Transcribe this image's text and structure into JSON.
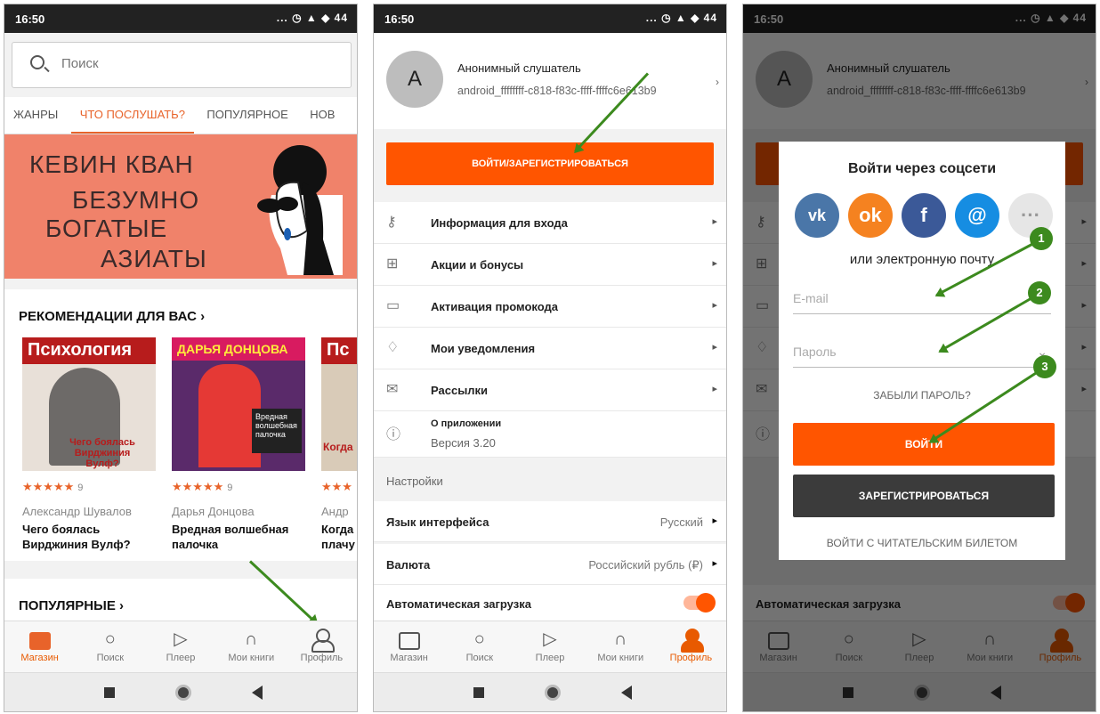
{
  "status": {
    "time": "16:50",
    "icons": "... ◷ ▲ ◆ 44"
  },
  "screen1": {
    "search_placeholder": "Поиск",
    "categories": [
      "ЖАНРЫ",
      "ЧТО ПОСЛУШАТЬ?",
      "ПОПУЛЯРНОЕ",
      "НОВ"
    ],
    "banner": {
      "line1": "КЕВИН КВАН",
      "line2": "БЕЗУМНО",
      "line3": "БОГАТЫЕ",
      "line4": "АЗИАТЫ",
      "color": "#f0826a"
    },
    "rec_title": "РЕКОМЕНДАЦИИ ДЛЯ ВАС",
    "books": [
      {
        "cover_top": "Психология",
        "cover_bottom": "Чего боялась Вирджиния Вулф?",
        "rating": "★★★★★",
        "count": "9",
        "author": "Александр Шувалов",
        "title": "Чего боялась Вирджиния Вулф?"
      },
      {
        "cover_top": "ДАРЬЯ ДОНЦОВА",
        "cover_bottom": "Вредная волшебная палочка",
        "rating": "★★★★★",
        "count": "9",
        "author": "Дарья Донцова",
        "title": "Вредная волшебная палочка"
      },
      {
        "cover_top": "Пс",
        "cover_bottom": "Когда",
        "rating": "★★★",
        "count": "",
        "author": "Андр",
        "title": "Когда плачу"
      }
    ],
    "popular_title": "ПОПУЛЯРНЫЕ"
  },
  "tabs": [
    "Магазин",
    "Поиск",
    "Плеер",
    "Мои книги",
    "Профиль"
  ],
  "profile": {
    "avatar": "A",
    "name": "Анонимный слушатель",
    "id": "android_ffffffff-c818-f83c-ffff-ffffc6e613b9",
    "login_button": "ВОЙТИ/ЗАРЕГИСТРИРОВАТЬСЯ",
    "menu": [
      "Информация для входа",
      "Акции и бонусы",
      "Активация промокода",
      "Мои уведомления",
      "Рассылки"
    ],
    "about": "О приложении",
    "version": "Версия 3.20",
    "settings_label": "Настройки",
    "language_label": "Язык интерфейса",
    "language_value": "Русский",
    "currency_label": "Валюта",
    "currency_value": "Российский рубль (₽)",
    "autoload_label": "Автоматическая загрузка",
    "accent": "#ff5500"
  },
  "dialog": {
    "title": "Войти через соцсети",
    "social": [
      "vk",
      "ok",
      "f",
      "@",
      "···"
    ],
    "or_email": "или электронную почту",
    "email_placeholder": "E-mail",
    "password_placeholder": "Пароль",
    "forgot": "ЗАБЫЛИ ПАРОЛЬ?",
    "login": "ВОЙТИ",
    "register": "ЗАРЕГИСТРИРОВАТЬСЯ",
    "ticket": "ВОЙТИ С ЧИТАТЕЛЬСКИМ БИЛЕТОМ",
    "markers": [
      "1",
      "2",
      "3"
    ]
  }
}
